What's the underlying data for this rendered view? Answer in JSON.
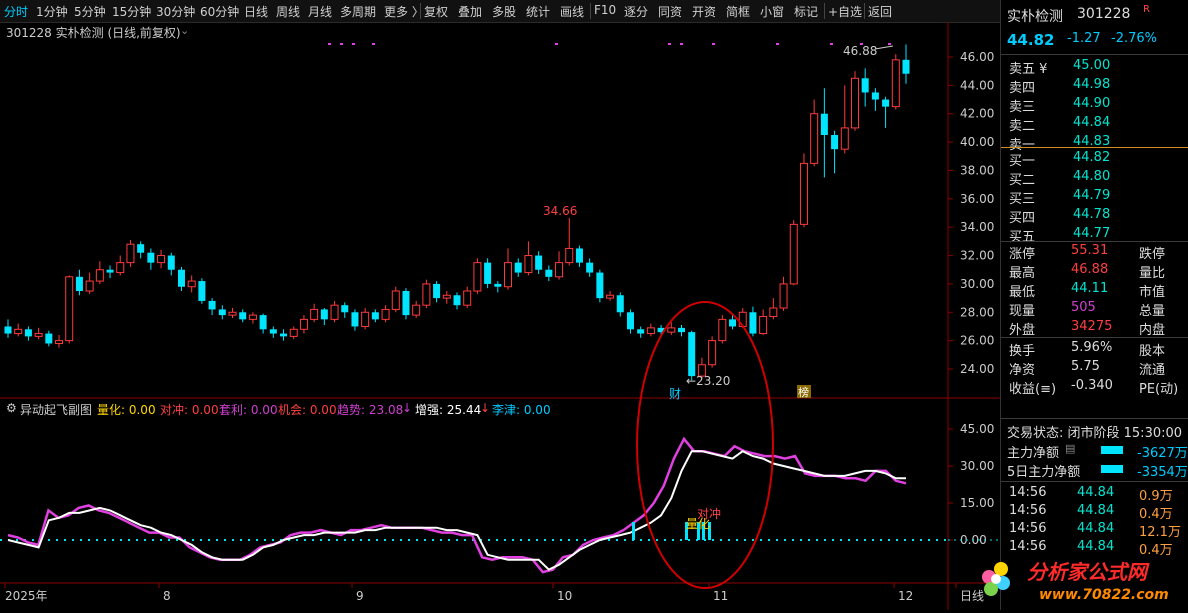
{
  "toolbar": {
    "items": [
      "分时",
      "1分钟",
      "5分钟",
      "15分钟",
      "30分钟",
      "60分钟",
      "日线",
      "周线",
      "月线",
      "多周期",
      "更多 〉",
      "复权",
      "叠加",
      "多股",
      "统计",
      "画线",
      "F10",
      "逐分",
      "同资",
      "开资",
      "简框",
      "小窗",
      "标记",
      "+自选",
      "返回"
    ],
    "active_index": 0
  },
  "chart_header": {
    "title": "301228 实朴检测 (日线,前复权)"
  },
  "price_axis": [
    "46.00",
    "44.00",
    "42.00",
    "40.00",
    "38.00",
    "36.00",
    "34.00",
    "32.00",
    "30.00",
    "28.00",
    "26.00",
    "24.00"
  ],
  "ind_axis": [
    "45.00",
    "30.00",
    "15.00",
    "0.00"
  ],
  "date_axis": [
    "2025年",
    "8",
    "9",
    "10",
    "11",
    "12",
    "日线"
  ],
  "annotations": {
    "high_label": "34.66",
    "recent_high": "46.88",
    "low_label": "23.20",
    "cai": "财",
    "bang": "榜",
    "duichong": "对冲",
    "lianghua": "量化"
  },
  "indicator": {
    "name": "异动起飞副图",
    "lianghua": "量化: 0.00",
    "duichong": "对冲: 0.00",
    "taoli": "套利: 0.00",
    "jihui": "机会: 0.00",
    "qushi": "趋势: 23.08",
    "qushi_arrow": "↓",
    "zengqiang": "增强: 25.44",
    "zengqiang_arrow": "↓",
    "likou": "李津: 0.00"
  },
  "quote": {
    "name": "实朴检测",
    "code": "301228",
    "badge": "R",
    "price": "44.82",
    "change": "-1.27",
    "pct": "-2.76%",
    "sell": [
      {
        "label": "卖五 ¥",
        "price": "45.00"
      },
      {
        "label": "卖四",
        "price": "44.98"
      },
      {
        "label": "卖三",
        "price": "44.90"
      },
      {
        "label": "卖二",
        "price": "44.84"
      },
      {
        "label": "卖一",
        "price": "44.83"
      }
    ],
    "buy": [
      {
        "label": "买一",
        "price": "44.82"
      },
      {
        "label": "买二",
        "price": "44.80"
      },
      {
        "label": "买三",
        "price": "44.79"
      },
      {
        "label": "买四",
        "price": "44.78"
      },
      {
        "label": "买五",
        "price": "44.77"
      }
    ],
    "stats": [
      {
        "l": "涨停",
        "v": "55.31",
        "r": "跌停"
      },
      {
        "l": "最高",
        "v": "46.88",
        "r": "量比"
      },
      {
        "l": "最低",
        "v": "44.11",
        "r": "市值"
      },
      {
        "l": "现量",
        "v": "505",
        "r": "总量"
      },
      {
        "l": "外盘",
        "v": "34275",
        "r": "内盘"
      },
      {
        "l": "换手",
        "v": "5.96%",
        "r": "股本"
      },
      {
        "l": "净资",
        "v": "5.75",
        "r": "流通"
      },
      {
        "l": "收益(≡)",
        "v": "-0.340",
        "r": "PE(动)"
      }
    ],
    "status": "交易状态: 闭市阶段 15:30:00",
    "main_flow_label": "主力净额",
    "main_flow_value": "-3627万",
    "flow5_label": "5日主力净额",
    "flow5_value": "-3354万",
    "ticks": [
      {
        "t": "14:56",
        "p": "44.84",
        "v": "0.9万"
      },
      {
        "t": "14:56",
        "p": "44.84",
        "v": "0.4万"
      },
      {
        "t": "14:56",
        "p": "44.84",
        "v": "12.1万"
      },
      {
        "t": "14:56",
        "p": "44.84",
        "v": "0.4万"
      }
    ]
  },
  "watermark": {
    "text": "分析家公式网",
    "url": "www.70822.com"
  },
  "chart_data": {
    "type": "candlestick",
    "ylim": [
      23,
      47.5
    ],
    "candles": [
      [
        27.0,
        26.5,
        27.5,
        26.2
      ],
      [
        26.5,
        26.8,
        27.2,
        26.3
      ],
      [
        26.8,
        26.3,
        27.0,
        26.0
      ],
      [
        26.3,
        26.5,
        26.9,
        26.1
      ],
      [
        26.5,
        25.8,
        26.7,
        25.6
      ],
      [
        25.8,
        26.0,
        26.4,
        25.5
      ],
      [
        26.0,
        30.5,
        30.6,
        25.8
      ],
      [
        30.5,
        29.5,
        31.0,
        29.2
      ],
      [
        29.5,
        30.2,
        30.8,
        29.3
      ],
      [
        30.2,
        31.0,
        31.6,
        30.0
      ],
      [
        31.0,
        30.8,
        31.3,
        30.4
      ],
      [
        30.8,
        31.5,
        32.0,
        30.6
      ],
      [
        31.5,
        32.8,
        33.1,
        31.2
      ],
      [
        32.8,
        32.2,
        33.0,
        31.8
      ],
      [
        32.2,
        31.5,
        32.5,
        31.0
      ],
      [
        31.5,
        32.0,
        32.4,
        31.1
      ],
      [
        32.0,
        31.0,
        32.2,
        30.6
      ],
      [
        31.0,
        29.8,
        31.2,
        29.5
      ],
      [
        29.8,
        30.2,
        30.6,
        29.4
      ],
      [
        30.2,
        28.8,
        30.4,
        28.6
      ],
      [
        28.8,
        28.2,
        29.0,
        27.8
      ],
      [
        28.2,
        27.8,
        28.5,
        27.5
      ],
      [
        27.8,
        28.0,
        28.3,
        27.6
      ],
      [
        28.0,
        27.5,
        28.2,
        27.3
      ],
      [
        27.5,
        27.8,
        28.0,
        27.2
      ],
      [
        27.8,
        26.8,
        27.9,
        26.5
      ],
      [
        26.8,
        26.5,
        27.0,
        26.2
      ],
      [
        26.5,
        26.3,
        26.8,
        26.0
      ],
      [
        26.3,
        26.8,
        27.0,
        26.1
      ],
      [
        26.8,
        27.5,
        27.8,
        26.5
      ],
      [
        27.5,
        28.2,
        28.6,
        27.3
      ],
      [
        28.2,
        27.5,
        28.3,
        27.1
      ],
      [
        27.5,
        28.5,
        28.8,
        27.3
      ],
      [
        28.5,
        28.0,
        28.7,
        27.6
      ],
      [
        28.0,
        27.0,
        28.2,
        26.7
      ],
      [
        27.0,
        28.0,
        28.3,
        26.8
      ],
      [
        28.0,
        27.5,
        28.2,
        27.3
      ],
      [
        27.5,
        28.2,
        28.5,
        27.3
      ],
      [
        28.2,
        29.5,
        29.8,
        28.0
      ],
      [
        29.5,
        27.8,
        29.7,
        27.5
      ],
      [
        27.8,
        28.5,
        28.8,
        27.6
      ],
      [
        28.5,
        30.0,
        30.3,
        28.3
      ],
      [
        30.0,
        29.0,
        30.2,
        28.7
      ],
      [
        29.0,
        29.2,
        29.5,
        28.6
      ],
      [
        29.2,
        28.5,
        29.4,
        28.2
      ],
      [
        28.5,
        29.5,
        29.8,
        28.3
      ],
      [
        29.5,
        31.5,
        31.8,
        29.3
      ],
      [
        31.5,
        30.0,
        31.8,
        29.7
      ],
      [
        30.0,
        29.8,
        30.2,
        29.4
      ],
      [
        29.8,
        31.5,
        32.5,
        29.6
      ],
      [
        31.5,
        30.8,
        31.8,
        30.5
      ],
      [
        30.8,
        32.0,
        33.0,
        30.6
      ],
      [
        32.0,
        31.0,
        32.3,
        30.7
      ],
      [
        31.0,
        30.5,
        31.3,
        30.2
      ],
      [
        30.5,
        31.5,
        32.3,
        30.3
      ],
      [
        31.5,
        32.5,
        34.66,
        31.3
      ],
      [
        32.5,
        31.5,
        32.7,
        31.2
      ],
      [
        31.5,
        30.8,
        31.8,
        30.5
      ],
      [
        30.8,
        29.0,
        31.0,
        28.7
      ],
      [
        29.0,
        29.2,
        29.5,
        28.8
      ],
      [
        29.2,
        28.0,
        29.4,
        27.7
      ],
      [
        28.0,
        26.8,
        28.2,
        26.5
      ],
      [
        26.8,
        26.5,
        27.0,
        26.2
      ],
      [
        26.5,
        26.9,
        27.2,
        26.3
      ],
      [
        26.9,
        26.6,
        27.1,
        26.3
      ],
      [
        26.6,
        26.9,
        27.3,
        26.4
      ],
      [
        26.9,
        26.6,
        27.1,
        26.3
      ],
      [
        26.6,
        23.5,
        26.7,
        23.2
      ],
      [
        23.5,
        24.3,
        24.8,
        23.4
      ],
      [
        24.3,
        26.0,
        26.3,
        24.1
      ],
      [
        26.0,
        27.5,
        27.8,
        25.8
      ],
      [
        27.5,
        27.0,
        27.8,
        26.8
      ],
      [
        27.0,
        28.0,
        28.3,
        26.9
      ],
      [
        28.0,
        26.5,
        28.4,
        26.3
      ],
      [
        26.5,
        27.7,
        28.2,
        26.4
      ],
      [
        27.7,
        28.3,
        29.0,
        27.5
      ],
      [
        28.3,
        30.0,
        30.5,
        28.1
      ],
      [
        30.0,
        34.2,
        34.5,
        29.9
      ],
      [
        34.2,
        38.5,
        39.2,
        34.0
      ],
      [
        38.5,
        42.0,
        43.0,
        38.3
      ],
      [
        42.0,
        40.5,
        43.8,
        37.5
      ],
      [
        40.5,
        39.5,
        40.8,
        37.8
      ],
      [
        39.5,
        41.0,
        44.0,
        39.2
      ],
      [
        41.0,
        44.5,
        45.0,
        40.8
      ],
      [
        44.5,
        43.5,
        45.2,
        42.5
      ],
      [
        43.5,
        43.0,
        43.8,
        42.2
      ],
      [
        43.0,
        42.5,
        43.2,
        41.0
      ],
      [
        42.5,
        45.8,
        46.2,
        42.3
      ],
      [
        45.8,
        44.82,
        46.88,
        44.11
      ]
    ]
  }
}
